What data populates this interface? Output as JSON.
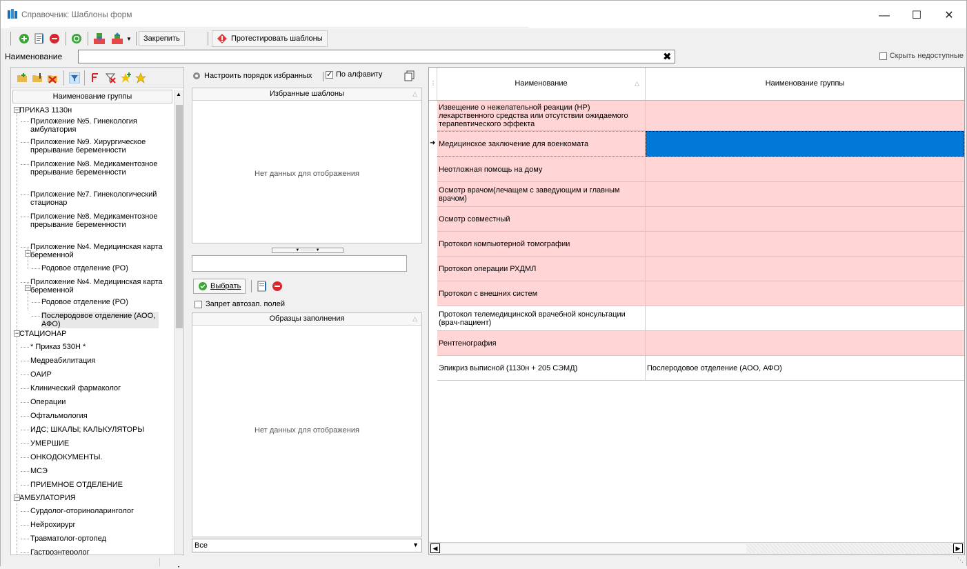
{
  "window": {
    "title": "Справочник: Шаблоны форм"
  },
  "toolbar": {
    "pin_label": "Закрепить",
    "test_label": "Протестировать шаблоны"
  },
  "search": {
    "label": "Наименование",
    "value": "",
    "hide_unavailable": "Скрыть недоступные"
  },
  "tree": {
    "header": "Наименование группы",
    "nodes": [
      "ПРИКАЗ 1130н",
      "Приложение №5. Гинекология амбулатория",
      "Приложение №9. Хирургическое прерывание беременности",
      "Приложение №8. Медикаментозное прерывание беременности",
      "Приложение №7. Гинекологический стационар",
      "Приложение №8. Медикаментозное прерывание беременности",
      "Приложение №4. Медицинская карта беременной",
      "Родовое отделение (РО)",
      "Приложение №4. Медицинская карта беременной",
      "Родовое отделение (РО)",
      "Послеродовое отделение (АОО, АФО)",
      "СТАЦИОНАР",
      "* Приказ 530Н *",
      "Медреабилитация",
      "ОАИР",
      "Клинический фармаколог",
      "Операции",
      "Офтальмология",
      "ИДС; ШКАЛЫ; КАЛЬКУЛЯТОРЫ",
      "УМЕРШИЕ",
      "ОНКОДОКУМЕНТЫ.",
      "МСЭ",
      "ПРИЕМНОЕ ОТДЕЛЕНИЕ",
      "АМБУЛАТОРИЯ",
      "Сурдолог-оториноларинголог",
      "Нейрохирург",
      "Травматолог-ортопед",
      "Гастроэнтеролог"
    ]
  },
  "favorites": {
    "configure_label": "Настроить порядок избранных",
    "alpha_label": "По алфавиту",
    "header": "Избранные шаблоны",
    "empty": "Нет данных для отображения"
  },
  "actions": {
    "select_label": "Выбрать",
    "autofill_lock": "Запрет автозап. полей"
  },
  "samples": {
    "header": "Образцы заполнения",
    "empty": "Нет данных для отображения",
    "filter_value": "Все"
  },
  "grid": {
    "col_name": "Наименование",
    "col_group": "Наименование группы",
    "rows": [
      {
        "name": "Извещение о нежелательной реакции (НР) лекарственного средства или отсутствии ожидаемого терапевтического эффекта",
        "group": ""
      },
      {
        "name": "Медицинское заключение для военкомата",
        "group": ""
      },
      {
        "name": "Неотложная помощь на дому",
        "group": ""
      },
      {
        "name": "Осмотр врачом(лечащем с заведующим и главным врачом)",
        "group": ""
      },
      {
        "name": "Осмотр совместный",
        "group": ""
      },
      {
        "name": "Протокол компьютерной томографии",
        "group": ""
      },
      {
        "name": "Протокол операции РХДМЛ",
        "group": ""
      },
      {
        "name": "Протокол с внешних систем",
        "group": ""
      },
      {
        "name": "Протокол телемедицинской врачебной консультации (врач-пациент)",
        "group": ""
      },
      {
        "name": "Рентгенография",
        "group": ""
      },
      {
        "name": "Эпикриз выписной (1130н + 205 СЭМД)",
        "group": "Послеродовое отделение (АОО, АФО)"
      }
    ]
  },
  "colors": {
    "pink_row": "#ffd5d5",
    "selection": "#0078d7"
  }
}
